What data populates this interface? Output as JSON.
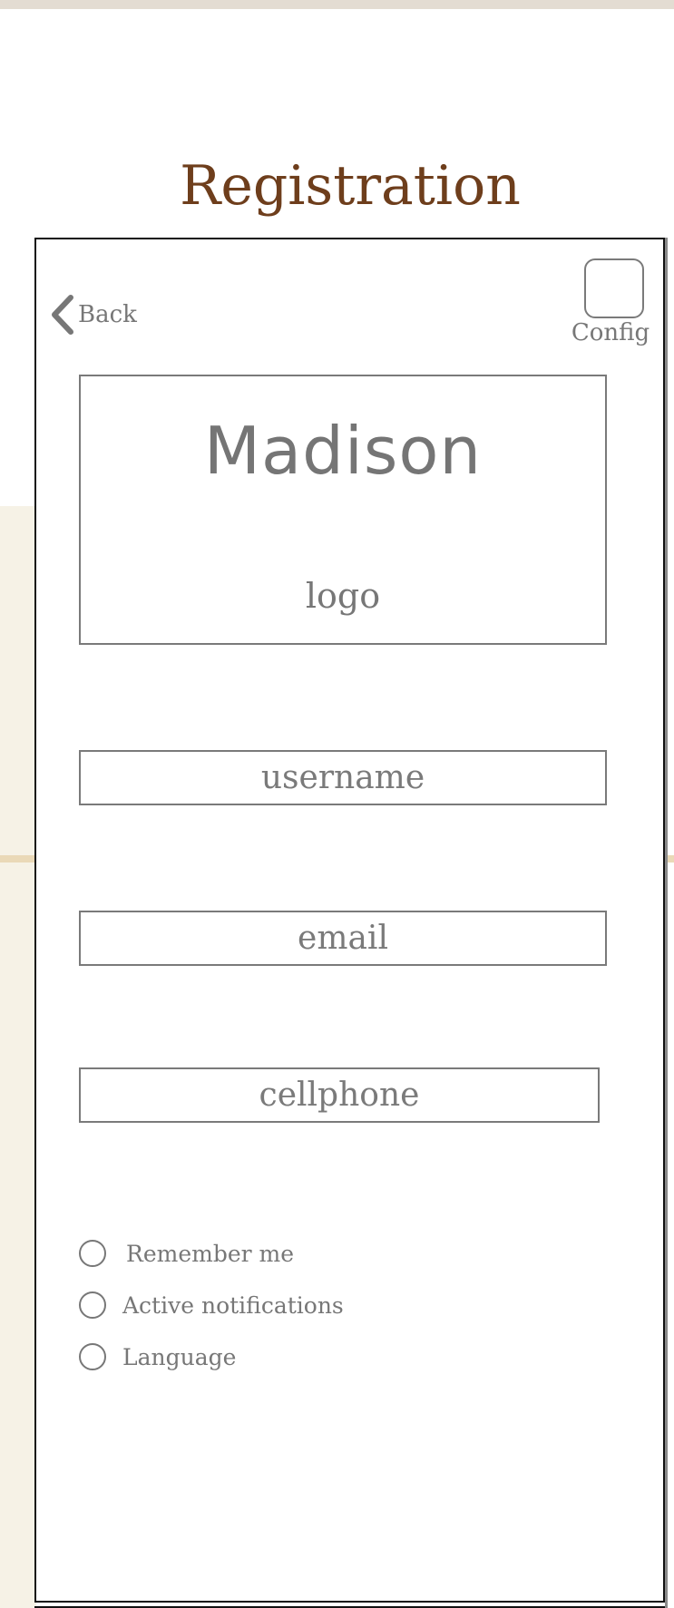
{
  "page": {
    "title": "Registration"
  },
  "nav": {
    "back_label": "Back",
    "config_label": "Config"
  },
  "logo": {
    "name": "Madison",
    "caption": "logo"
  },
  "form": {
    "username_placeholder": "username",
    "email_placeholder": "email",
    "cellphone_placeholder": "cellphone"
  },
  "options": [
    {
      "label": "Remember me",
      "selected": false
    },
    {
      "label": "Active notifications",
      "selected": false
    },
    {
      "label": "Language",
      "selected": false
    }
  ],
  "colors": {
    "title": "#6e3e1c",
    "outline": "#7a7a7a",
    "side_panel": "#f6f2e6",
    "accent_line": "#ead9b7"
  },
  "icons": {
    "back": "chevron-left-icon",
    "config": "rounded-square-icon"
  }
}
